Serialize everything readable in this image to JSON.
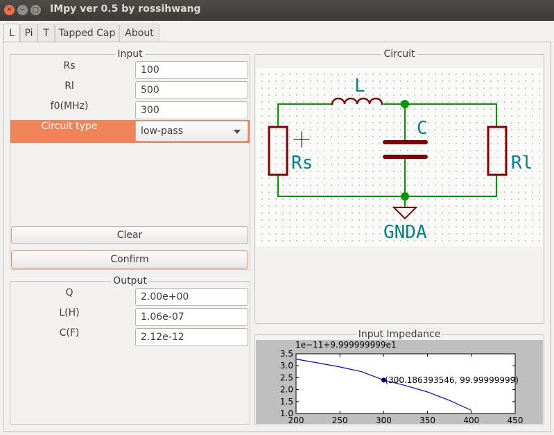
{
  "window": {
    "title": "IMpy ver 0.5 by rossihwang"
  },
  "tabs": [
    {
      "label": "L",
      "active": true
    },
    {
      "label": "Pi"
    },
    {
      "label": "T"
    },
    {
      "label": "Tapped Cap"
    },
    {
      "label": "About"
    }
  ],
  "input": {
    "title": "Input",
    "rs_label": "Rs",
    "rs_value": "100",
    "rl_label": "Rl",
    "rl_value": "500",
    "f0_label": "f0(MHz)",
    "f0_value": "300",
    "circuit_type_label": "Circuit type",
    "circuit_type_value": "low-pass",
    "clear_label": "Clear",
    "confirm_label": "Confirm"
  },
  "output": {
    "title": "Output",
    "q_label": "Q",
    "q_value": "2.00e+00",
    "l_label": "L(H)",
    "l_value": "1.06e-07",
    "c_label": "C(F)",
    "c_value": "2.12e-12"
  },
  "circuit": {
    "title": "Circuit",
    "labels": {
      "inductor": "L",
      "capacitor": "C",
      "source": "Rs",
      "load": "Rl",
      "ground": "GNDA"
    },
    "colors": {
      "wire": "#009a00",
      "component": "#840000",
      "text": "#008484"
    }
  },
  "impedance": {
    "title": "Input Impedance",
    "offset_text": "1e−11+9.999999999e1",
    "annotation": "(300.186393546, 99.99999999)"
  },
  "chart_data": {
    "type": "line",
    "title": "",
    "xlabel": "",
    "ylabel": "",
    "xlim": [
      200,
      450
    ],
    "ylim": [
      1.0,
      3.5
    ],
    "x_ticks": [
      "200",
      "250",
      "300",
      "350",
      "400",
      "450"
    ],
    "y_ticks": [
      "1.0",
      "1.5",
      "2.0",
      "2.5",
      "3.0",
      "3.5"
    ],
    "series": [
      {
        "x": [
          200,
          225,
          250,
          275,
          300,
          325,
          350,
          375,
          400
        ],
        "y": [
          3.28,
          3.12,
          2.95,
          2.75,
          2.4,
          2.17,
          1.9,
          1.55,
          1.13
        ],
        "color": "#0000ff"
      }
    ],
    "marker": {
      "x": 300,
      "y": 2.4
    },
    "grid": false
  }
}
